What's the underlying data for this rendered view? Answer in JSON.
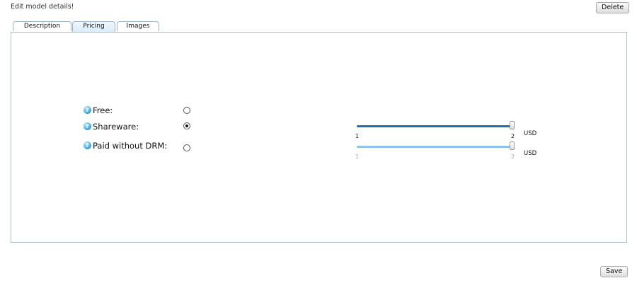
{
  "header": {
    "title": "Edit model details!",
    "delete_label": "Delete"
  },
  "tabs": [
    {
      "label": "Description",
      "active": false
    },
    {
      "label": "Pricing",
      "active": true
    },
    {
      "label": "Images",
      "active": false
    }
  ],
  "pricing": {
    "options": [
      {
        "label": "Free:",
        "checked": false
      },
      {
        "label": "Shareware:",
        "checked": true
      },
      {
        "label": "Paid without DRM:",
        "checked": false
      }
    ],
    "sliders": [
      {
        "min_label": "1",
        "max_label": "2",
        "value": 2,
        "unit": "USD"
      },
      {
        "min_label": "1",
        "max_label": "2",
        "value": 2,
        "unit": "USD"
      }
    ]
  },
  "footer": {
    "save_label": "Save"
  },
  "colors": {
    "accent": "#1f6fb8",
    "accent_light": "#8ec4ea",
    "panel_border": "#a9bccd"
  }
}
